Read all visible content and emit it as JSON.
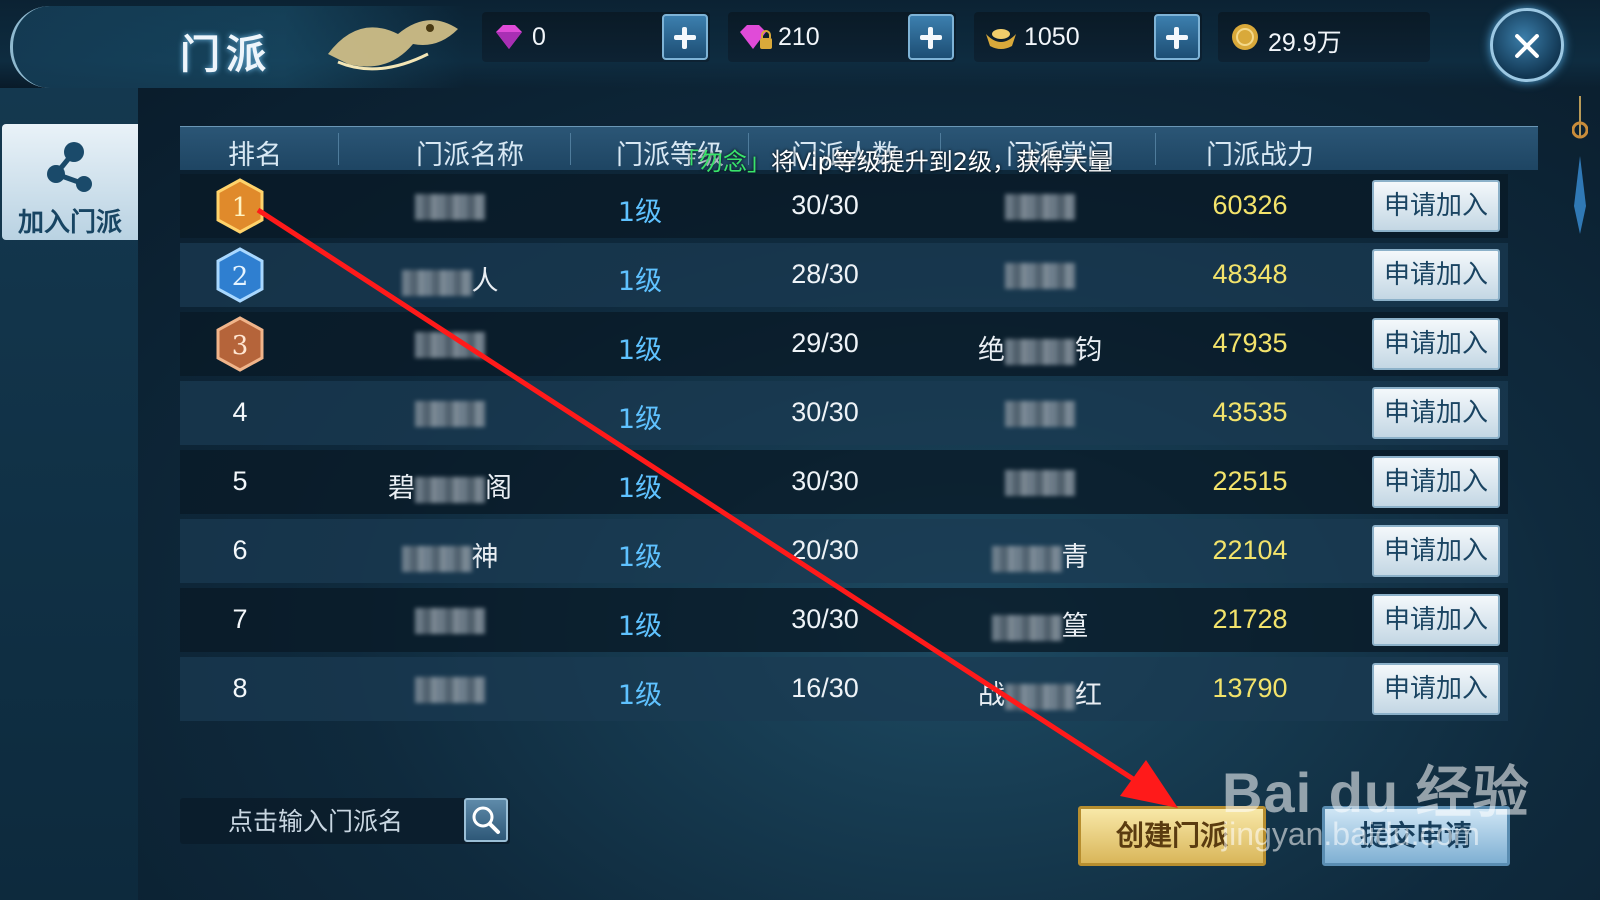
{
  "header": {
    "title": "门派"
  },
  "currencies": [
    {
      "icon": "diamond-icon",
      "value": "0"
    },
    {
      "icon": "locked-diamond-icon",
      "value": "210"
    },
    {
      "icon": "gold-ingot-icon",
      "value": "1050"
    },
    {
      "icon": "coin-icon",
      "value": "29.9万"
    }
  ],
  "sidebar": {
    "tab_label": "加入门派",
    "tab_icon": "network-icon"
  },
  "table": {
    "columns": [
      "排名",
      "门派名称",
      "门派等级",
      "门派人数",
      "门派掌门",
      "门派战力"
    ],
    "marquee": {
      "tag": "「勿念」",
      "text": "将Vip等级提升到2级，获得大量"
    },
    "apply_label": "申请加入",
    "rows": [
      {
        "rank": "1",
        "name_suffix": "",
        "level": "1级",
        "members": "30/30",
        "leader_prefix": "",
        "leader_suffix": "",
        "power": "60326"
      },
      {
        "rank": "2",
        "name_suffix": "人",
        "level": "1级",
        "members": "28/30",
        "leader_prefix": "",
        "leader_suffix": "",
        "power": "48348"
      },
      {
        "rank": "3",
        "name_suffix": "",
        "level": "1级",
        "members": "29/30",
        "leader_prefix": "绝",
        "leader_suffix": "钧",
        "power": "47935"
      },
      {
        "rank": "4",
        "name_suffix": "",
        "level": "1级",
        "members": "30/30",
        "leader_prefix": "",
        "leader_suffix": "",
        "power": "43535"
      },
      {
        "rank": "5",
        "name_prefix": "碧",
        "name_suffix": "阁",
        "level": "1级",
        "members": "30/30",
        "leader_prefix": "",
        "leader_suffix": "",
        "power": "22515"
      },
      {
        "rank": "6",
        "name_suffix": "神",
        "level": "1级",
        "members": "20/30",
        "leader_prefix": "",
        "leader_suffix": "青",
        "power": "22104"
      },
      {
        "rank": "7",
        "name_suffix": "",
        "level": "1级",
        "members": "30/30",
        "leader_prefix": "",
        "leader_suffix": "篁",
        "power": "21728"
      },
      {
        "rank": "8",
        "name_suffix": "",
        "level": "1级",
        "members": "16/30",
        "leader_prefix": "战",
        "leader_suffix": "红",
        "power": "13790"
      }
    ]
  },
  "footer": {
    "search_placeholder": "点击输入门派名",
    "create_label": "创建门派",
    "submit_label": "提交申请"
  },
  "watermark": {
    "brand": "Bai du 经验",
    "site": "jingyan.baidu.com"
  },
  "colors": {
    "level": "#5fc2ff",
    "power": "#f3e36b",
    "annotation_arrow": "#ff1a1a"
  }
}
